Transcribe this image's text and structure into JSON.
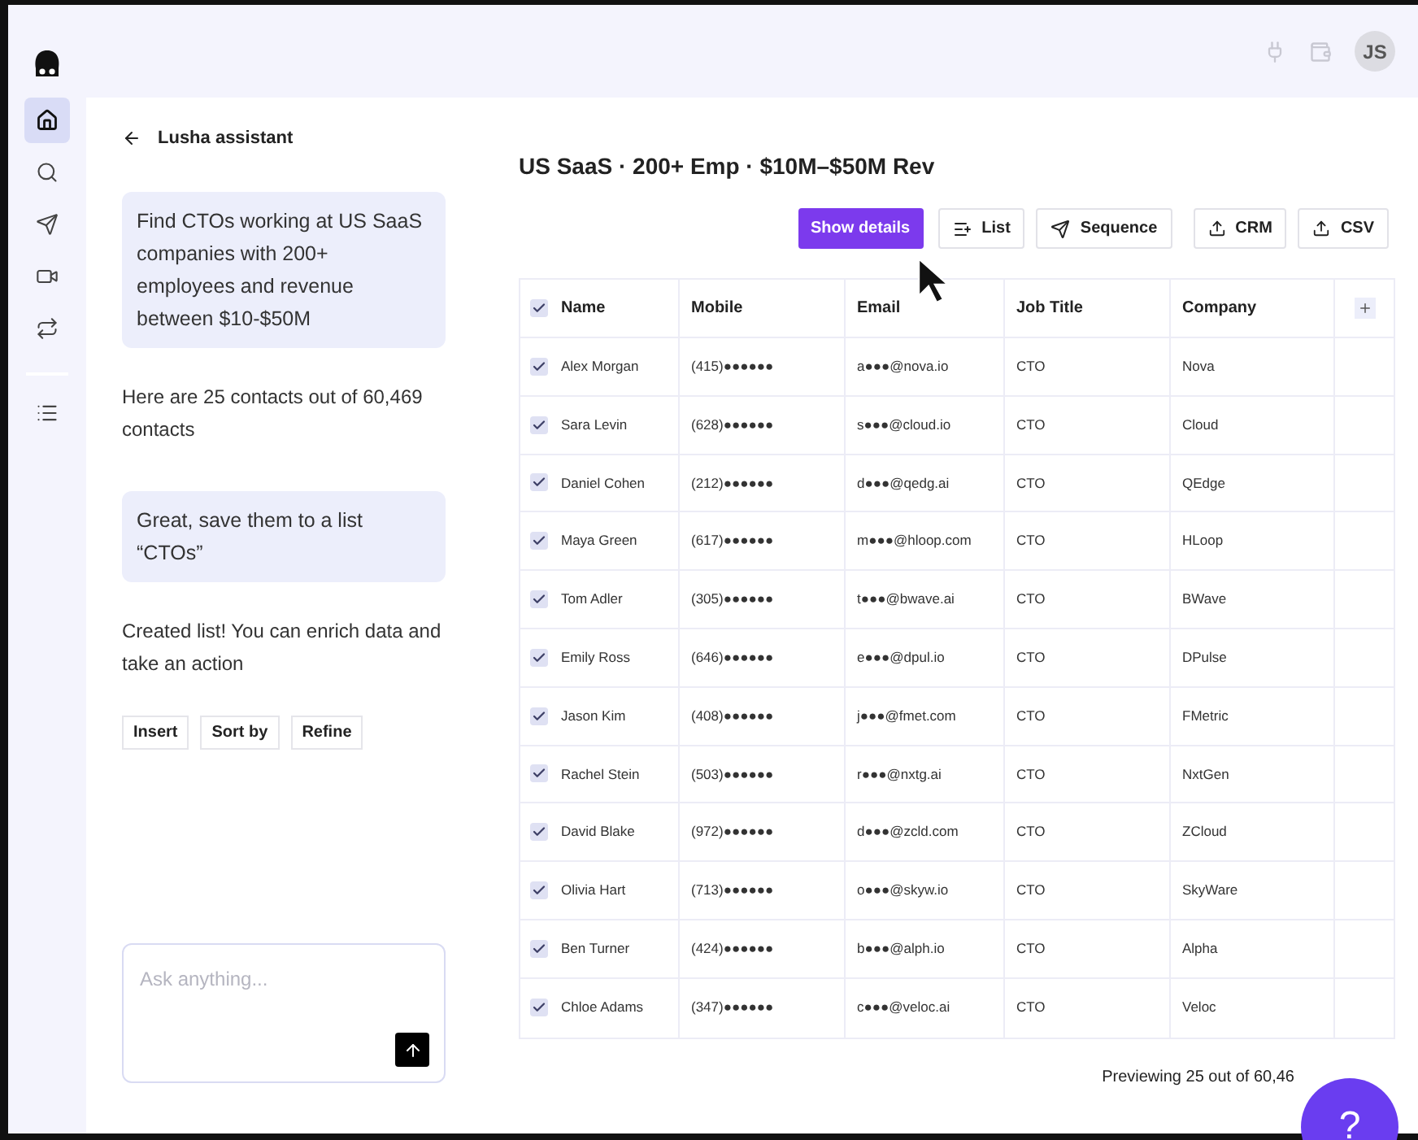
{
  "header": {
    "avatar": "JS"
  },
  "nav": [
    {
      "kind": "home",
      "selected": true
    },
    {
      "kind": "search",
      "selected": false
    },
    {
      "kind": "send",
      "selected": false
    },
    {
      "kind": "video",
      "selected": false
    },
    {
      "kind": "sync",
      "selected": false
    }
  ],
  "nav_bottom": [
    {
      "kind": "list",
      "selected": false
    }
  ],
  "assistant": {
    "title": "Lusha assistant",
    "messages": [
      {
        "kind": "user",
        "text": "Find CTOs working at US SaaS companies with 200+ employees and revenue between $10-$50M"
      },
      {
        "kind": "bot",
        "text": "Here are 25 contacts out of 60,469 contacts"
      },
      {
        "kind": "user",
        "text": "Great, save them to a list “CTOs”"
      },
      {
        "kind": "bot",
        "text": "Created list! You can enrich data and take an action"
      }
    ],
    "actions": [
      "Insert",
      "Sort by",
      "Refine"
    ],
    "input": {
      "placeholder": "Ask anything..."
    }
  },
  "results": {
    "title": "US SaaS · 200+ Emp · $10M–$50M Rev",
    "toolbar": [
      {
        "kind": "primary",
        "label": "Show details"
      },
      {
        "kind": "list",
        "label": "List"
      },
      {
        "kind": "send",
        "label": "Sequence"
      },
      {
        "kind": "export",
        "label": "CRM"
      },
      {
        "kind": "export",
        "label": "CSV"
      }
    ],
    "table": {
      "all_checked": true,
      "columns": [
        "Name",
        "Mobile",
        "Email",
        "Job Title",
        "Company"
      ],
      "rows": [
        {
          "checked": true,
          "cells": [
            "Alex Morgan",
            "(415)●●●●●●",
            "a●●●@nova.io",
            "CTO",
            "Nova"
          ]
        },
        {
          "checked": true,
          "cells": [
            "Sara Levin",
            "(628)●●●●●●",
            "s●●●@cloud.io",
            "CTO",
            "Cloud"
          ]
        },
        {
          "checked": true,
          "cells": [
            "Daniel Cohen",
            "(212)●●●●●●",
            "d●●●@qedg.ai",
            "CTO",
            "QEdge"
          ]
        },
        {
          "checked": true,
          "cells": [
            "Maya Green",
            "(617)●●●●●●",
            "m●●●@hloop.com",
            "CTO",
            "HLoop"
          ]
        },
        {
          "checked": true,
          "cells": [
            "Tom Adler",
            "(305)●●●●●●",
            "t●●●@bwave.ai",
            "CTO",
            "BWave"
          ]
        },
        {
          "checked": true,
          "cells": [
            "Emily Ross",
            "(646)●●●●●●",
            "e●●●@dpul.io",
            "CTO",
            "DPulse"
          ]
        },
        {
          "checked": true,
          "cells": [
            "Jason Kim",
            "(408)●●●●●●",
            "j●●●@fmet.com",
            "CTO",
            "FMetric"
          ]
        },
        {
          "checked": true,
          "cells": [
            "Rachel Stein",
            "(503)●●●●●●",
            "r●●●@nxtg.ai",
            "CTO",
            "NxtGen"
          ]
        },
        {
          "checked": true,
          "cells": [
            "David Blake",
            "(972)●●●●●●",
            "d●●●@zcld.com",
            "CTO",
            "ZCloud"
          ]
        },
        {
          "checked": true,
          "cells": [
            "Olivia Hart",
            "(713)●●●●●●",
            "o●●●@skyw.io",
            "CTO",
            "SkyWare"
          ]
        },
        {
          "checked": true,
          "cells": [
            "Ben Turner",
            "(424)●●●●●●",
            "b●●●@alph.io",
            "CTO",
            "Alpha"
          ]
        },
        {
          "checked": true,
          "cells": [
            "Chloe Adams",
            "(347)●●●●●●",
            "c●●●@veloc.ai",
            "CTO",
            "Veloc"
          ]
        }
      ]
    },
    "footer": "Previewing 25 out of 60,46",
    "help": "?"
  }
}
